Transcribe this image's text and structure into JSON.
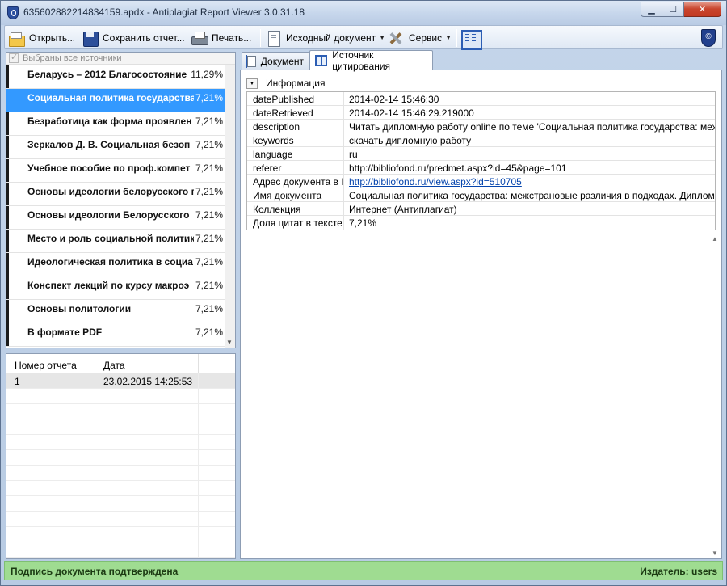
{
  "window": {
    "title": "635602882214834159.apdx - Antiplagiat Report Viewer 3.0.31.18"
  },
  "toolbar": {
    "open_label": "Открыть...",
    "save_label": "Сохранить отчет...",
    "print_label": "Печать...",
    "source_doc_label": "Исходный документ",
    "service_label": "Сервис"
  },
  "sources": {
    "select_all_label": "Выбраны все источники",
    "items": [
      {
        "name": "Беларусь – 2012 Благосостояние",
        "pct": "11,29%"
      },
      {
        "name": "Социальная политика государства",
        "pct": "7,21%"
      },
      {
        "name": "Безработица как форма проявлен",
        "pct": "7,21%"
      },
      {
        "name": "Зеркалов Д. В. Социальная безоп",
        "pct": "7,21%"
      },
      {
        "name": "Учебное пособие по проф.компет",
        "pct": "7,21%"
      },
      {
        "name": "Основы идеологии белорусского г",
        "pct": "7,21%"
      },
      {
        "name": "Основы идеологии Белорусского",
        "pct": "7,21%"
      },
      {
        "name": "Место и роль социальной политик",
        "pct": "7,21%"
      },
      {
        "name": "Идеологическая политика в социа",
        "pct": "7,21%"
      },
      {
        "name": "Конспект лекций по курсу макроэ",
        "pct": "7,21%"
      },
      {
        "name": "Основы политологии",
        "pct": "7,21%"
      },
      {
        "name": "В формате PDF",
        "pct": "7,21%"
      }
    ],
    "selected_index": 1
  },
  "reports": {
    "columns": [
      "Номер отчета",
      "Дата"
    ],
    "rows": [
      {
        "num": "1",
        "date": "23.02.2015 14:25:53"
      }
    ]
  },
  "tabs": {
    "document_label": "Документ",
    "citation_label": "Источник цитирования"
  },
  "info": {
    "section_label": "Информация",
    "rows": [
      {
        "key": "datePublished",
        "value": "2014-02-14 15:46:30"
      },
      {
        "key": "dateRetrieved",
        "value": "2014-02-14 15:46:29.219000"
      },
      {
        "key": "description",
        "value": "Читать дипломную работу online по теме 'Социальная политика государства: межстр..."
      },
      {
        "key": "keywords",
        "value": "скачать дипломную работу"
      },
      {
        "key": "language",
        "value": "ru"
      },
      {
        "key": "referer",
        "value": "http://bibliofond.ru/predmet.aspx?id=45&page=101"
      },
      {
        "key": "Адрес документа в I...",
        "value": "http://bibliofond.ru/view.aspx?id=510705"
      },
      {
        "key": "Имя документа",
        "value": "Социальная политика государства: межстрановые различия в подходах. Диплом. Чи..."
      },
      {
        "key": "Коллекция",
        "value": "Интернет (Антиплагиат)"
      },
      {
        "key": "Доля цитат в тексте",
        "value": "7,21%"
      }
    ]
  },
  "status": {
    "left": "Подпись документа подтверждена",
    "right": "Издатель: users"
  },
  "colors": {
    "selection": "#3399ff",
    "status_bg": "#9fdc91",
    "link": "#0645ad"
  }
}
